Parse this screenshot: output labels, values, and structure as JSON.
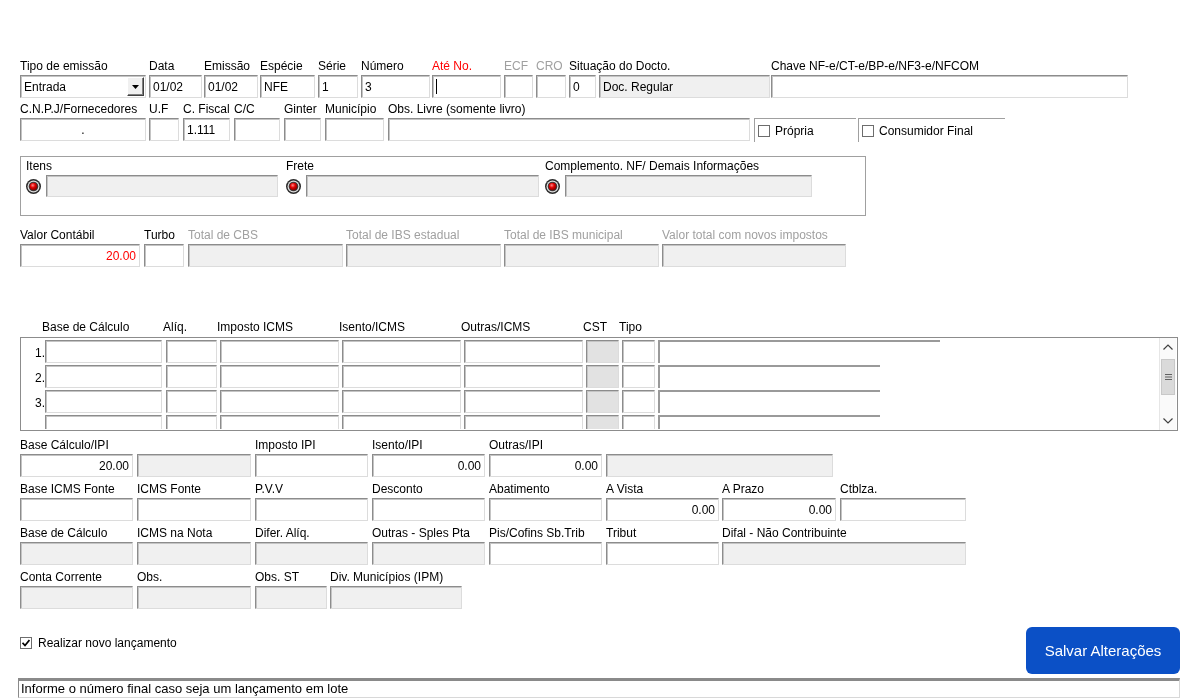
{
  "header_row": [
    {
      "label": "Tipo de emissão",
      "disabled": false,
      "highlighted": false,
      "fields": [
        {
          "kind": "dropdown",
          "value": "Entrada",
          "read_only": false,
          "focused": false
        }
      ]
    },
    {
      "label": "Data",
      "disabled": false,
      "highlighted": false,
      "fields": [
        {
          "kind": "text",
          "value": "01/02",
          "read_only": false,
          "focused": false
        }
      ]
    },
    {
      "label": "Emissão",
      "disabled": false,
      "highlighted": false,
      "fields": [
        {
          "kind": "text",
          "value": "01/02",
          "read_only": false,
          "focused": false
        }
      ]
    },
    {
      "label": "Espécie",
      "disabled": false,
      "highlighted": false,
      "fields": [
        {
          "kind": "text",
          "value": "NFE",
          "read_only": false,
          "focused": false
        }
      ]
    },
    {
      "label": "Série",
      "disabled": false,
      "highlighted": false,
      "fields": [
        {
          "kind": "text",
          "value": "1",
          "read_only": false,
          "focused": false
        }
      ]
    },
    {
      "label": "Número",
      "disabled": false,
      "highlighted": false,
      "fields": [
        {
          "kind": "text",
          "value": "3",
          "read_only": false,
          "focused": false
        }
      ]
    },
    {
      "label": "Até No.",
      "disabled": false,
      "highlighted": true,
      "fields": [
        {
          "read_only": false,
          "focused": true
        }
      ]
    },
    {
      "label": "ECF",
      "disabled": true,
      "highlighted": false,
      "fields": [
        {
          "read_only": false,
          "focused": false
        }
      ]
    },
    {
      "label": "CRO",
      "disabled": true,
      "highlighted": false,
      "fields": [
        {
          "read_only": false,
          "focused": false
        }
      ]
    },
    {
      "label": "Situação do Docto.",
      "disabled": false,
      "highlighted": false,
      "fields": [
        {
          "kind": "text",
          "value": "0",
          "read_only": false,
          "focused": false
        },
        {
          "kind": "text",
          "value": "Doc. Regular",
          "read_only": true,
          "focused": false
        }
      ]
    },
    {
      "label": "Chave NF-e/CT-e/BP-e/NF3-e/NFCOM",
      "disabled": false,
      "highlighted": false,
      "fields": [
        {
          "read_only": false,
          "focused": false
        }
      ]
    }
  ],
  "party_row": {
    "groups": [
      {
        "label": "C.N.P.J/Fornecedores",
        "fields": [
          {
            "kind": "masked",
            "value": "."
          }
        ]
      },
      {
        "label": "U.F"
      },
      {
        "label": "C. Fiscal",
        "fields": [
          {
            "kind": "text",
            "value": "1.111"
          }
        ]
      },
      {
        "label": "C/C"
      },
      {
        "label": "Ginter"
      },
      {
        "label": "Município"
      },
      {
        "label": "Obs. Livre (somente livro)"
      }
    ],
    "options": [
      {
        "label": "Própria",
        "checked": false
      },
      {
        "label": "Consumidor Final",
        "checked": false
      }
    ]
  },
  "links_box": [
    {
      "label": "Itens",
      "fields": [
        {
          "read_only": true
        }
      ]
    },
    {
      "label": "Frete",
      "fields": [
        {
          "read_only": true
        }
      ]
    },
    {
      "label": "Complemento. NF/ Demais Informações",
      "fields": [
        {
          "read_only": true
        }
      ]
    }
  ],
  "totals_row": [
    {
      "label": "Valor Contábil",
      "disabled": false,
      "fields": [
        {
          "kind": "number",
          "value": "20.00",
          "read_only": false,
          "highlighted": true
        }
      ]
    },
    {
      "label": "Turbo",
      "disabled": false,
      "fields": [
        {
          "read_only": false
        }
      ]
    },
    {
      "label": "Total de CBS",
      "disabled": true,
      "fields": [
        {
          "read_only": true
        }
      ]
    },
    {
      "label": "Total de IBS estadual",
      "disabled": true,
      "fields": [
        {
          "read_only": true
        }
      ]
    },
    {
      "label": "Total de IBS municipal",
      "disabled": true,
      "fields": [
        {
          "read_only": true
        }
      ]
    },
    {
      "label": "Valor total com novos impostos",
      "disabled": true,
      "fields": [
        {
          "read_only": true
        }
      ]
    }
  ],
  "icms_grid": {
    "columns": [
      {
        "label": "Base de Cálculo",
        "read_only": false
      },
      {
        "label": "Alíq.",
        "read_only": false
      },
      {
        "label": "Imposto ICMS",
        "read_only": false
      },
      {
        "label": "Isento/ICMS",
        "read_only": false
      },
      {
        "label": "Outras/ICMS",
        "read_only": false
      },
      {
        "label": "CST",
        "read_only": true
      },
      {
        "label": "Tipo",
        "read_only": false
      }
    ],
    "rows": [
      {
        "number": "1."
      },
      {
        "number": "2."
      },
      {
        "number": "3."
      }
    ]
  },
  "ipi_row": [
    {
      "label": "Base Cálculo/IPI",
      "fields": [
        {
          "kind": "number",
          "value": "20.00",
          "read_only": false
        }
      ]
    },
    {
      "fields": [
        {
          "read_only": true
        }
      ]
    },
    {
      "label": "Imposto IPI",
      "fields": [
        {
          "read_only": false
        }
      ]
    },
    {
      "label": "Isento/IPI",
      "fields": [
        {
          "kind": "number",
          "value": "0.00",
          "read_only": false
        }
      ]
    },
    {
      "label": "Outras/IPI",
      "fields": [
        {
          "kind": "number",
          "value": "0.00",
          "read_only": false
        }
      ]
    },
    {
      "fields": [
        {
          "read_only": true
        }
      ]
    }
  ],
  "source_row": [
    {
      "label": "Base ICMS Fonte"
    },
    {
      "label": "ICMS Fonte"
    },
    {
      "label": "P.V.V"
    },
    {
      "label": "Desconto"
    },
    {
      "label": "Abatimento"
    },
    {
      "label": "A Vista",
      "fields": [
        {
          "kind": "number",
          "value": "0.00"
        }
      ]
    },
    {
      "label": "A Prazo",
      "fields": [
        {
          "kind": "number",
          "value": "0.00"
        }
      ]
    },
    {
      "label": "Ctblza."
    }
  ],
  "calc_row": [
    {
      "label": "Base de Cálculo",
      "fields": [
        {
          "read_only": true
        }
      ]
    },
    {
      "label": "ICMS na Nota",
      "fields": [
        {
          "read_only": true
        }
      ]
    },
    {
      "label": "Difer. Alíq.",
      "fields": [
        {
          "read_only": true
        }
      ]
    },
    {
      "label": "Outras - Sples Pta",
      "fields": [
        {
          "read_only": true
        }
      ]
    },
    {
      "label": "Pis/Cofins Sb.Trib",
      "fields": [
        {
          "read_only": false
        }
      ]
    },
    {
      "label": "Tribut",
      "fields": [
        {
          "read_only": false
        }
      ]
    },
    {
      "label": "Difal - Não Contribuinte",
      "fields": [
        {
          "read_only": true
        }
      ]
    }
  ],
  "account_row": [
    {
      "label": "Conta Corrente",
      "fields": [
        {
          "read_only": true
        }
      ]
    },
    {
      "label": "Obs.",
      "fields": [
        {
          "read_only": true
        }
      ]
    },
    {
      "label": "Obs. ST",
      "fields": [
        {
          "read_only": true
        }
      ]
    },
    {
      "label": "Div. Municípios (IPM)",
      "fields": [
        {
          "read_only": true
        }
      ]
    }
  ],
  "new_entry_option": {
    "label": "Realizar novo lançamento",
    "checked": true
  },
  "save_button": "Salvar Alterações",
  "status_bar": "Informe o número final caso seja um lançamento em lote"
}
